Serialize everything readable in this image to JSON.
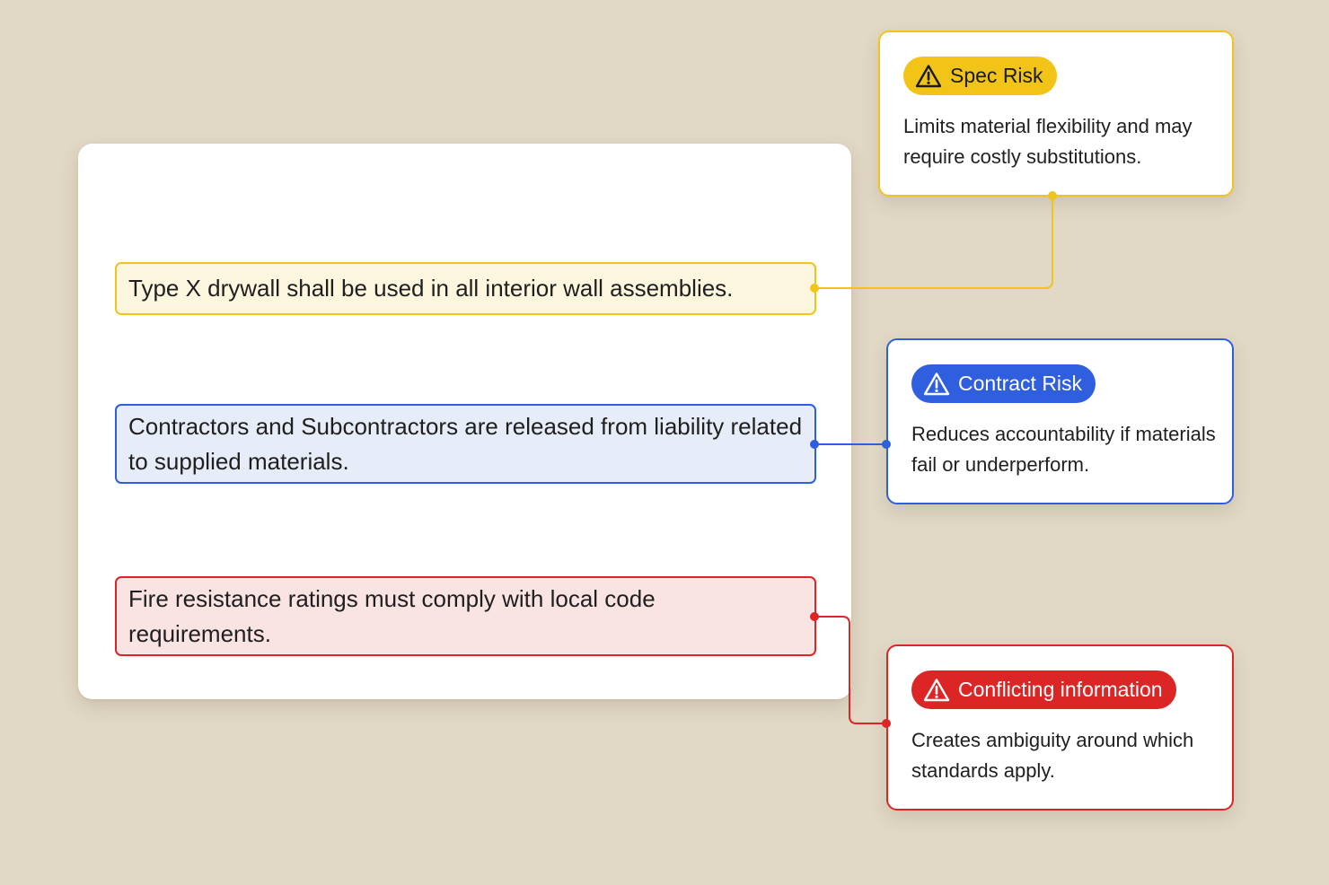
{
  "clauses": [
    {
      "type": "spec",
      "text": "Type X drywall shall be used in all interior wall assemblies.",
      "color": "#f0c41b",
      "fill": "#fcf6df"
    },
    {
      "type": "contract",
      "text": "Contractors and Subcontractors are released from liability related to supplied materials.",
      "color": "#2f5fde",
      "fill": "#e6ecf8"
    },
    {
      "type": "conflict",
      "text": "Fire resistance ratings must comply with local code requirements.",
      "color": "#dc2626",
      "fill": "#fae3e3"
    }
  ],
  "risks": [
    {
      "type": "spec",
      "label": "Spec Risk",
      "icon": "warning-triangle-icon",
      "description": "Limits material flexibility and may require costly substitutions.",
      "color": "#f2c418"
    },
    {
      "type": "contract",
      "label": "Contract Risk",
      "icon": "warning-triangle-icon",
      "description": "Reduces accountability if materials fail or underperform.",
      "color": "#2f5fde"
    },
    {
      "type": "conflict",
      "label": "Conflicting information",
      "icon": "warning-triangle-icon",
      "description": "Creates ambiguity around which standards apply.",
      "color": "#dc2626"
    }
  ],
  "colors": {
    "background": "#e2d8c6",
    "document": "#ffffff",
    "placeholder": "#f0f0f0"
  }
}
